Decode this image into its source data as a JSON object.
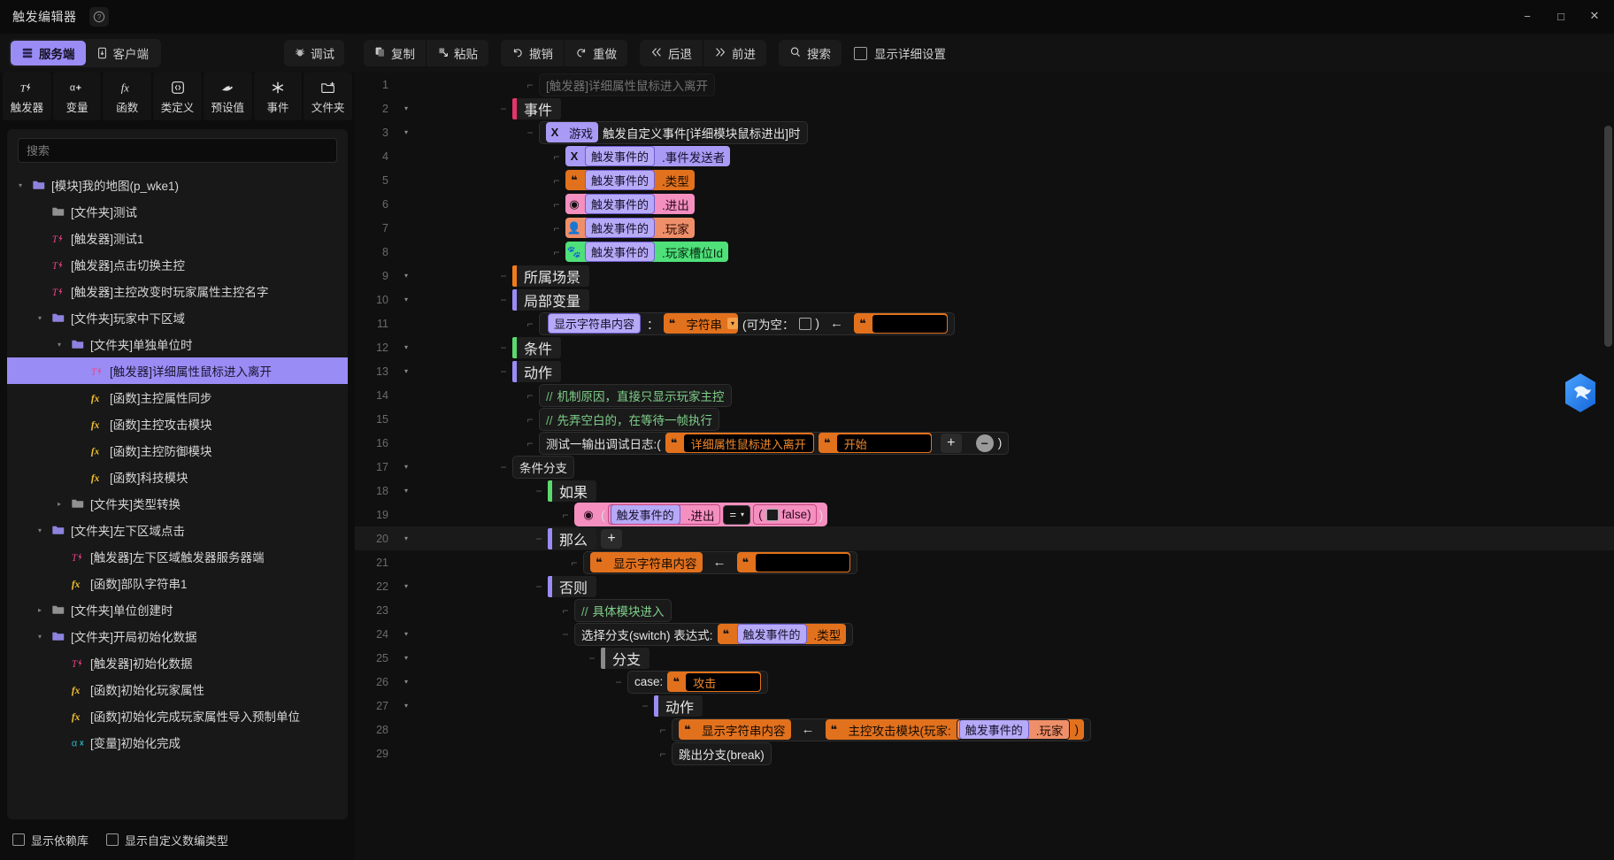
{
  "window": {
    "title": "触发编辑器",
    "help_icon": "help-icon",
    "minimize": "−",
    "maximize": "□",
    "close": "✕"
  },
  "left_panel": {
    "mode_tabs": [
      {
        "label": "服务端",
        "icon": "server-icon",
        "active": true
      },
      {
        "label": "客户端",
        "icon": "mobile-icon",
        "active": false
      }
    ],
    "debug_button": {
      "label": "调试",
      "icon": "bug-icon"
    },
    "tools": [
      {
        "label": "触发器",
        "icon": "trigger-icon"
      },
      {
        "label": "变量",
        "icon": "variable-icon"
      },
      {
        "label": "函数",
        "icon": "function-icon"
      },
      {
        "label": "类定义",
        "icon": "class-icon"
      },
      {
        "label": "预设值",
        "icon": "preset-icon"
      },
      {
        "label": "事件",
        "icon": "event-icon"
      },
      {
        "label": "文件夹",
        "icon": "folder-add-icon"
      }
    ],
    "search": {
      "placeholder": "搜索",
      "value": ""
    },
    "tree": [
      {
        "label": "[模块]我的地图(p_wke1)",
        "icon": "folder-open-icon",
        "depth": 0,
        "twisty": "down",
        "selected": false
      },
      {
        "label": "[文件夹]测试",
        "icon": "folder-icon",
        "depth": 1,
        "twisty": "",
        "selected": false
      },
      {
        "label": "[触发器]测试1",
        "icon": "trigger-icon",
        "depth": 1,
        "twisty": "",
        "selected": false
      },
      {
        "label": "[触发器]点击切换主控",
        "icon": "trigger-icon",
        "depth": 1,
        "twisty": "",
        "selected": false
      },
      {
        "label": "[触发器]主控改变时玩家属性主控名字",
        "icon": "trigger-icon",
        "depth": 1,
        "twisty": "",
        "selected": false
      },
      {
        "label": "[文件夹]玩家中下区域",
        "icon": "folder-open-icon",
        "depth": 1,
        "twisty": "down",
        "selected": false
      },
      {
        "label": "[文件夹]单独单位时",
        "icon": "folder-open-icon",
        "depth": 2,
        "twisty": "down",
        "selected": false
      },
      {
        "label": "[触发器]详细属性鼠标进入离开",
        "icon": "trigger-icon",
        "depth": 3,
        "twisty": "",
        "selected": true
      },
      {
        "label": "[函数]主控属性同步",
        "icon": "function-icon",
        "depth": 3,
        "twisty": "",
        "selected": false
      },
      {
        "label": "[函数]主控攻击模块",
        "icon": "function-icon",
        "depth": 3,
        "twisty": "",
        "selected": false
      },
      {
        "label": "[函数]主控防御模块",
        "icon": "function-icon",
        "depth": 3,
        "twisty": "",
        "selected": false
      },
      {
        "label": "[函数]科技模块",
        "icon": "function-icon",
        "depth": 3,
        "twisty": "",
        "selected": false
      },
      {
        "label": "[文件夹]类型转换",
        "icon": "folder-icon",
        "depth": 2,
        "twisty": "right",
        "selected": false
      },
      {
        "label": "[文件夹]左下区域点击",
        "icon": "folder-open-icon",
        "depth": 1,
        "twisty": "down",
        "selected": false
      },
      {
        "label": "[触发器]左下区域触发器服务器端",
        "icon": "trigger-icon",
        "depth": 2,
        "twisty": "",
        "selected": false
      },
      {
        "label": "[函数]部队字符串1",
        "icon": "function-icon",
        "depth": 2,
        "twisty": "",
        "selected": false
      },
      {
        "label": "[文件夹]单位创建时",
        "icon": "folder-icon",
        "depth": 1,
        "twisty": "right",
        "selected": false
      },
      {
        "label": "[文件夹]开局初始化数据",
        "icon": "folder-open-icon",
        "depth": 1,
        "twisty": "down",
        "selected": false
      },
      {
        "label": "[触发器]初始化数据",
        "icon": "trigger-icon",
        "depth": 2,
        "twisty": "",
        "selected": false
      },
      {
        "label": "[函数]初始化玩家属性",
        "icon": "function-icon",
        "depth": 2,
        "twisty": "",
        "selected": false
      },
      {
        "label": "[函数]初始化完成玩家属性导入预制单位",
        "icon": "function-icon",
        "depth": 2,
        "twisty": "",
        "selected": false
      },
      {
        "label": "[变量]初始化完成",
        "icon": "variable-icon",
        "depth": 2,
        "twisty": "",
        "selected": false
      }
    ],
    "footer_checks": [
      {
        "label": "显示依赖库",
        "checked": false
      },
      {
        "label": "显示自定义数编类型",
        "checked": false
      }
    ]
  },
  "toolbar": {
    "groups": [
      [
        {
          "label": "复制",
          "icon": "copy-icon"
        },
        {
          "label": "粘贴",
          "icon": "paste-icon"
        }
      ],
      [
        {
          "label": "撤销",
          "icon": "undo-icon"
        },
        {
          "label": "重做",
          "icon": "redo-icon"
        }
      ],
      [
        {
          "label": "后退",
          "icon": "back-icon"
        },
        {
          "label": "前进",
          "icon": "forward-icon"
        }
      ],
      [
        {
          "label": "搜索",
          "icon": "search-icon"
        }
      ]
    ],
    "detail_checkbox": {
      "label": "显示详细设置",
      "checked": false
    }
  },
  "editor": {
    "badge_icon": "bird-hexagon-badge",
    "lines": [
      {
        "n": "1",
        "fold": "",
        "partial": true,
        "text_main": "[触发器]详细属性鼠标进入离开"
      },
      {
        "n": "2",
        "fold": "▾",
        "kw": "事件",
        "kw_color": "#e5356a"
      },
      {
        "n": "3",
        "fold": "▾",
        "event_tag": "游戏",
        "event_text": "触发自定义事件[详细模块鼠标进出]时"
      },
      {
        "n": "4",
        "fold": "",
        "chip_icon": "X",
        "chip_color": "c-purple",
        "pill": "触发事件的",
        "suffix": ".事件发送者"
      },
      {
        "n": "5",
        "fold": "",
        "chip_icon": "❝",
        "chip_color": "c-orange",
        "pill": "触发事件的",
        "suffix": ".类型"
      },
      {
        "n": "6",
        "fold": "",
        "chip_icon": "◉",
        "chip_color": "c-pink",
        "pill": "触发事件的",
        "suffix": ".进出"
      },
      {
        "n": "7",
        "fold": "",
        "chip_icon": "👤",
        "chip_color": "c-salmon",
        "pill": "触发事件的",
        "suffix": ".玩家"
      },
      {
        "n": "8",
        "fold": "",
        "chip_icon": "🐾",
        "chip_color": "c-green",
        "pill": "触发事件的",
        "suffix": ".玩家槽位Id"
      },
      {
        "n": "9",
        "fold": "▾",
        "kw": "所属场景",
        "kw_color": "#f07c1c"
      },
      {
        "n": "10",
        "fold": "▾",
        "kw": "局部变量",
        "kw_color": "#9a8cf5"
      },
      {
        "n": "11",
        "fold": "",
        "localvar": {
          "name": "显示字符串内容",
          "colon": "：",
          "type_icon": "❝",
          "type": "字符串",
          "nullable_label": "(可为空：",
          "nullable_close": ")",
          "arrow": "←",
          "value": ""
        }
      },
      {
        "n": "12",
        "fold": "▾",
        "kw": "条件",
        "kw_color": "#5bd96f"
      },
      {
        "n": "13",
        "fold": "▾",
        "kw": "动作",
        "kw_color": "#9a8cf5"
      },
      {
        "n": "14",
        "fold": "",
        "comment": "机制原因，直接只显示玩家主控"
      },
      {
        "n": "15",
        "fold": "",
        "comment": "先弄空白的，在等待一帧执行"
      },
      {
        "n": "16",
        "fold": "",
        "call": {
          "prefix": "测试一输出调试日志:(",
          "args": [
            {
              "icon": "❝",
              "text": "详细属性鼠标进入离开"
            },
            {
              "icon": "❝",
              "text": "开始"
            }
          ],
          "plus": "+",
          "minus": "−",
          "close": ")"
        }
      },
      {
        "n": "17",
        "fold": "▾",
        "plain": "条件分支"
      },
      {
        "n": "18",
        "fold": "▾",
        "kw": "如果",
        "kw_color": "#5bd96f"
      },
      {
        "n": "19",
        "fold": "",
        "condition": {
          "icon": "◉",
          "open": "(",
          "pill": "触发事件的",
          "field": ".进出",
          "op": "=",
          "rhs_open": "(",
          "rhs_check": "",
          "rhs_text": "false",
          "rhs_close": ")",
          "close": ")"
        }
      },
      {
        "n": "20",
        "fold": "▾",
        "kw": "那么",
        "kw_color": "#9a8cf5",
        "trailing_plus": "+",
        "highlighted": true
      },
      {
        "n": "21",
        "fold": "",
        "assign": {
          "icon": "❝",
          "target": "显示字符串内容",
          "arrow": "←",
          "src_icon": "❝",
          "value": ""
        }
      },
      {
        "n": "22",
        "fold": "▾",
        "kw": "否则",
        "kw_color": "#9a8cf5"
      },
      {
        "n": "23",
        "fold": "",
        "comment": "具体模块进入"
      },
      {
        "n": "24",
        "fold": "▾",
        "switch": {
          "prefix": "选择分支(switch) 表达式:",
          "icon": "❝",
          "pill": "触发事件的",
          "suffix": ".类型"
        }
      },
      {
        "n": "25",
        "fold": "▾",
        "kw": "分支",
        "kw_color": "#8a8a8a"
      },
      {
        "n": "26",
        "fold": "▾",
        "case": {
          "label": "case:",
          "icon": "❝",
          "value": "攻击"
        }
      },
      {
        "n": "27",
        "fold": "▾",
        "kw": "动作",
        "kw_color": "#9a8cf5"
      },
      {
        "n": "28",
        "fold": "",
        "assign2": {
          "icon": "❝",
          "target": "显示字符串内容",
          "arrow": "←",
          "src_icon": "❝",
          "fn_prefix": "主控攻击模块(玩家:",
          "pill": "触发事件的",
          "pill_suffix": ".玩家",
          "fn_close": ")"
        }
      },
      {
        "n": "29",
        "fold": "",
        "plain_cut": "跳出分支(break)"
      }
    ]
  }
}
